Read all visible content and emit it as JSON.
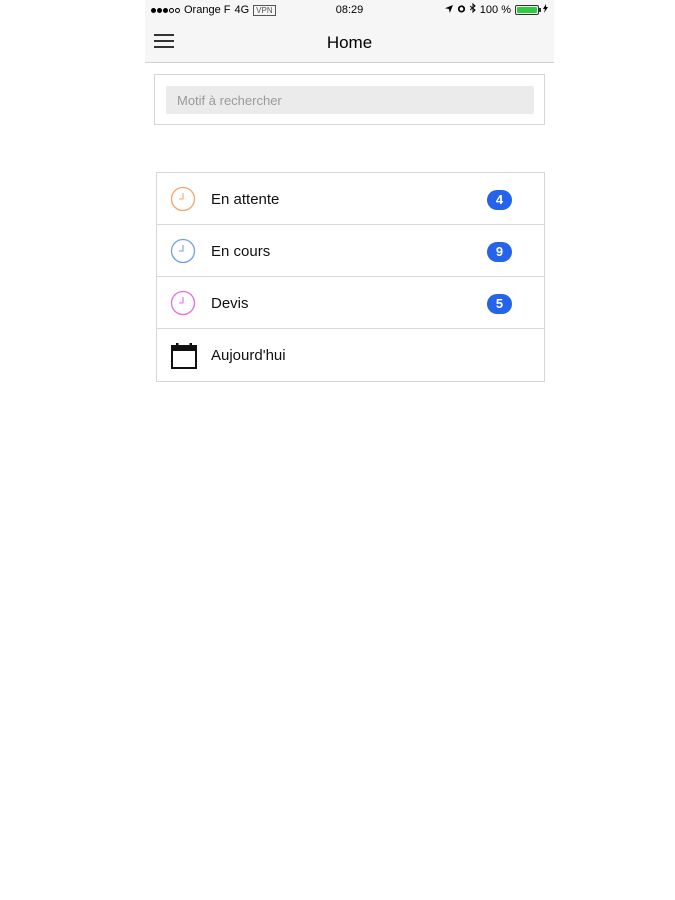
{
  "status_bar": {
    "carrier": "Orange F",
    "network": "4G",
    "vpn": "VPN",
    "time": "08:29",
    "battery": "100 %"
  },
  "nav": {
    "title": "Home",
    "menu_icon": "hamburger-menu-icon"
  },
  "search": {
    "placeholder": "Motif à rechercher",
    "value": ""
  },
  "items": [
    {
      "label": "En attente",
      "badge": "4",
      "icon": "clock-icon",
      "color": "#f4a56a"
    },
    {
      "label": "En cours",
      "badge": "9",
      "icon": "clock-icon",
      "color": "#6f9ef2"
    },
    {
      "label": "Devis",
      "badge": "5",
      "icon": "clock-icon",
      "color": "#e86be0"
    },
    {
      "label": "Aujourd'hui",
      "badge": "",
      "icon": "calendar-icon",
      "color": "#111111"
    }
  ],
  "colors": {
    "badge": "#2563eb",
    "battery": "#2ecc40"
  }
}
